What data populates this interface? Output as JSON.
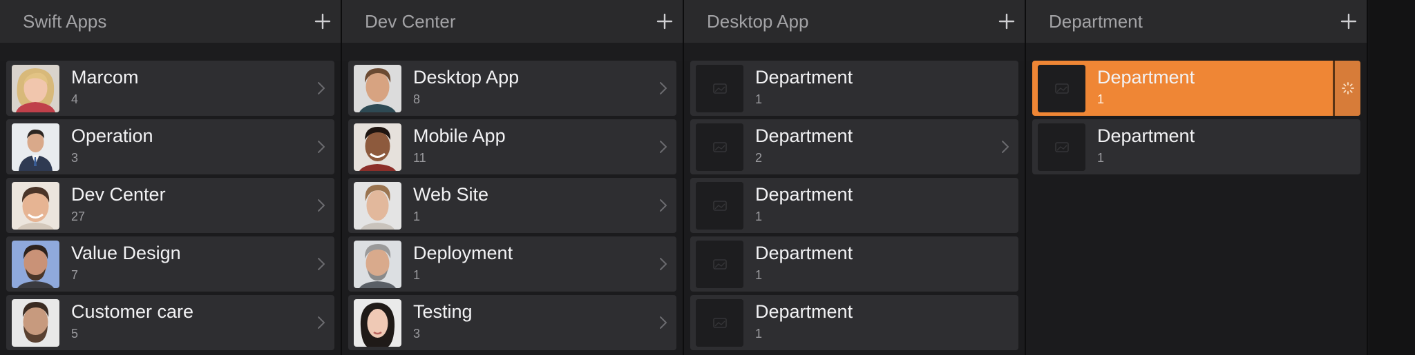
{
  "colors": {
    "header_bg": "#2a2a2c",
    "row_bg": "#2e2e31",
    "selected_row": "#ef8635",
    "text_primary": "#f2f2f4",
    "text_secondary": "#9b9b9f"
  },
  "columns": [
    {
      "title": "Swift Apps",
      "add_icon": "plus-icon",
      "rows": [
        {
          "title": "Marcom",
          "count": "4",
          "thumb": "avatar-woman-blonde"
        },
        {
          "title": "Operation",
          "count": "3",
          "thumb": "avatar-man-suit"
        },
        {
          "title": "Dev Center",
          "count": "27",
          "thumb": "avatar-man-smiling"
        },
        {
          "title": "Value Design",
          "count": "7",
          "thumb": "avatar-man-beard-blue"
        },
        {
          "title": "Customer care",
          "count": "5",
          "thumb": "avatar-man-beard"
        }
      ]
    },
    {
      "title": "Dev Center",
      "add_icon": "plus-icon",
      "rows": [
        {
          "title": "Desktop App",
          "count": "8",
          "thumb": "avatar-man-young"
        },
        {
          "title": "Mobile App",
          "count": "11",
          "thumb": "avatar-man-dark"
        },
        {
          "title": "Web Site",
          "count": "1",
          "thumb": "avatar-man-fair"
        },
        {
          "title": "Deployment",
          "count": "1",
          "thumb": "avatar-man-gray"
        },
        {
          "title": "Testing",
          "count": "3",
          "thumb": "avatar-woman-dark-hair"
        }
      ]
    },
    {
      "title": "Desktop App",
      "add_icon": "plus-icon",
      "rows": [
        {
          "title": "Department",
          "count": "1",
          "thumb": "image-placeholder-icon"
        },
        {
          "title": "Department",
          "count": "2",
          "thumb": "image-placeholder-icon"
        },
        {
          "title": "Department",
          "count": "1",
          "thumb": "image-placeholder-icon"
        },
        {
          "title": "Department",
          "count": "1",
          "thumb": "image-placeholder-icon"
        },
        {
          "title": "Department",
          "count": "1",
          "thumb": "image-placeholder-icon"
        }
      ]
    },
    {
      "title": "Department",
      "add_icon": "plus-icon",
      "rows": [
        {
          "title": "Department",
          "count": "1",
          "thumb": "image-placeholder-icon",
          "selected": true,
          "loading_icon": "spinner-icon"
        },
        {
          "title": "Department",
          "count": "1",
          "thumb": "image-placeholder-icon"
        }
      ]
    }
  ]
}
